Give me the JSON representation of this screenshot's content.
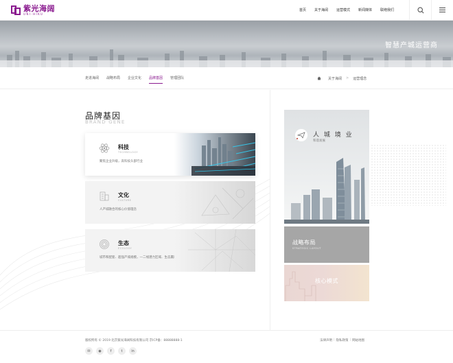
{
  "brand": {
    "logo_cn": "紫光海阔",
    "logo_en": "UNI-HIKU",
    "accent": "#8a1a8f"
  },
  "nav": {
    "items": [
      "首页",
      "关于海阔",
      "运营模式",
      "新闻媒体",
      "联络我们"
    ]
  },
  "banner": {
    "text": "智慧产城运营商"
  },
  "subnav": {
    "tabs": [
      "走进海阔",
      "战略布局",
      "企业文化",
      "品牌基因",
      "管理团队"
    ],
    "active_index": 3
  },
  "breadcrumb": [
    "关于海阔",
    "运营理念"
  ],
  "section": {
    "title": "品牌基因",
    "subtitle": "BRAND GENE"
  },
  "cards": [
    {
      "title": "科技",
      "en": "TECHNOLOGY",
      "desc": "聚焦企业升级，高科技头部行业",
      "icon": "atom-icon"
    },
    {
      "title": "文化",
      "en": "CULTURE",
      "desc": "人产城融合的核心价值理念",
      "icon": "building-icon"
    },
    {
      "title": "生态",
      "en": "ECOLOGY",
      "desc": "城市和配套、超强产城规模，一二线潜力区域、生态赢局",
      "icon": "target-icon"
    }
  ],
  "side_cards": [
    {
      "title": "人 城 境 业",
      "sub": "和谐发展",
      "icon": "paper-plane-icon"
    },
    {
      "title": "战略布局",
      "en": "STRATEGIC LAYOUT"
    },
    {
      "title": "核心模式"
    }
  ],
  "footer": {
    "copyright": "版权所有 © 2019 北京紫光海阔科技有限公司    京ICP备：88888888-1",
    "links": [
      "法律声明",
      "隐私政策",
      "网站地图"
    ],
    "socials": [
      "wechat-icon",
      "weibo-icon",
      "facebook-icon",
      "twitter-icon",
      "linkedin-icon"
    ]
  }
}
